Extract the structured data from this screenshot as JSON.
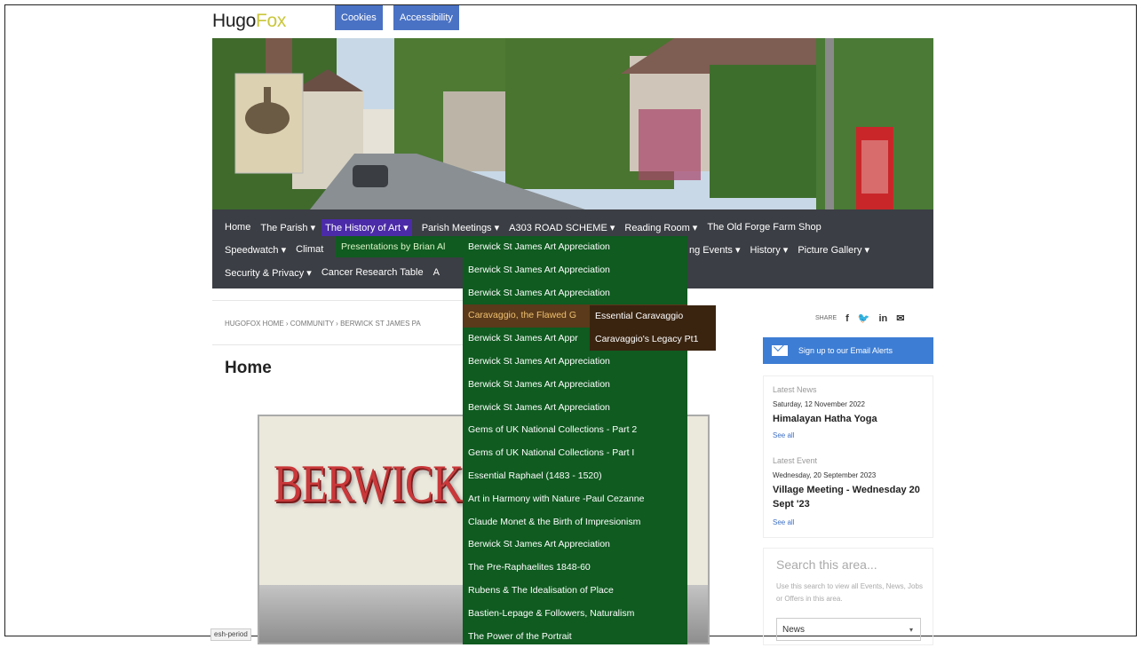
{
  "header": {
    "logo_hugo": "Hugo",
    "logo_fox": "Fox",
    "cookies_label": "Cookies",
    "accessibility_label": "Accessibility"
  },
  "nav": {
    "row1": [
      {
        "label": "Home",
        "active": false
      },
      {
        "label": "The Parish ▾",
        "active": false
      },
      {
        "label": "The History of Art ▾",
        "active": true
      },
      {
        "label": "Parish Meetings ▾",
        "active": false
      },
      {
        "label": "A303 ROAD SCHEME ▾",
        "active": false
      },
      {
        "label": "Reading Room ▾",
        "active": false
      },
      {
        "label": "The Old Forge Farm Shop",
        "active": false
      }
    ],
    "row2_left": [
      {
        "label": "Speedwatch ▾"
      },
      {
        "label": "Climat"
      }
    ],
    "row2_right": [
      {
        "label": "ng Events ▾"
      },
      {
        "label": "History ▾"
      },
      {
        "label": "Picture Gallery ▾"
      }
    ],
    "row3": [
      {
        "label": "Security & Privacy ▾"
      },
      {
        "label": "Cancer Research Table"
      },
      {
        "label": "A"
      }
    ]
  },
  "menu": {
    "presentations_label": "Presentations by Brian Al",
    "items": [
      "Berwick St James Art Appreciation",
      "Berwick St James Art Appreciation",
      "Berwick St James Art Appreciation",
      "Caravaggio, the Flawed G",
      "Berwick St James Art Appr",
      "Berwick St James Art Appreciation",
      "Berwick St James Art Appreciation",
      "Berwick St James Art Appreciation",
      "Gems of UK National Collections - Part 2",
      "Gems of UK National Collections - Part I",
      "Essential Raphael (1483 - 1520)",
      "Art in Harmony with Nature -Paul Cezanne",
      "Claude Monet & the Birth of Impresionism",
      "Berwick St James Art Appreciation",
      "The Pre-Raphaelites 1848-60",
      "Rubens & The Idealisation of Place",
      "Bastien-Lepage & Followers, Naturalism",
      "The Power of the Portrait"
    ],
    "highlighted_index": 3,
    "submenu": [
      "Essential Caravaggio",
      "Caravaggio's Legacy Pt1"
    ]
  },
  "breadcrumb": "HUGOFOX HOME › COMMUNITY › BERWICK ST JAMES PA",
  "main": {
    "title": "Home",
    "poster_text": "BERWICK"
  },
  "share": {
    "label": "SHARE",
    "facebook": "f",
    "twitter": "🐦",
    "linkedin": "in",
    "email": "✉"
  },
  "sidebar": {
    "alerts_label": "Sign up to our Email Alerts",
    "news": {
      "label": "Latest News",
      "date": "Saturday, 12 November 2022",
      "headline": "Himalayan Hatha Yoga",
      "see_all": "See all"
    },
    "event": {
      "label": "Latest Event",
      "date": "Wednesday, 20 September 2023",
      "headline": "Village Meeting - Wednesday 20 Sept '23",
      "see_all": "See all"
    },
    "search": {
      "title": "Search this area...",
      "desc": "Use this search to view all Events, News, Jobs or Offers in this area.",
      "select_value": "News"
    }
  },
  "status_bar": "esh-period"
}
